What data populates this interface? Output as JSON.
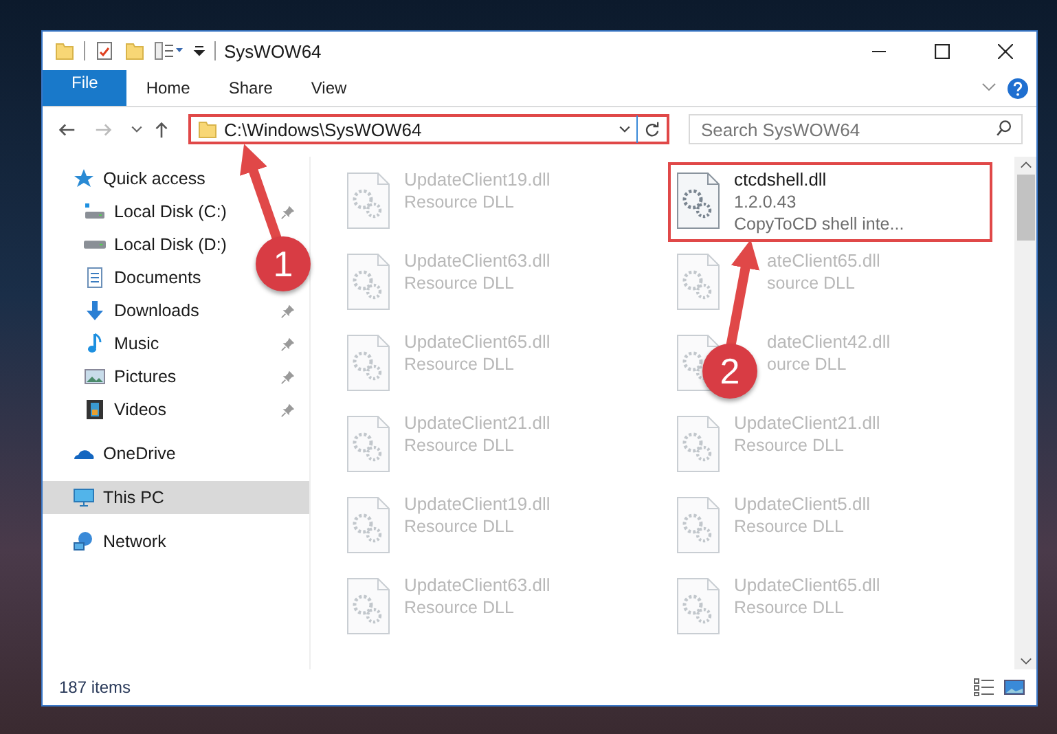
{
  "window": {
    "title": "SysWOW64"
  },
  "ribbon_tabs": [
    {
      "label": "File",
      "kind": "file"
    },
    {
      "label": "Home",
      "kind": "tab"
    },
    {
      "label": "Share",
      "kind": "tab"
    },
    {
      "label": "View",
      "kind": "tab"
    }
  ],
  "address_bar": {
    "path": "C:\\Windows\\SysWOW64",
    "highlighted": true
  },
  "search": {
    "placeholder": "Search SysWOW64"
  },
  "navigation": [
    {
      "label": "Quick access",
      "kind": "quick",
      "selected": false,
      "children": [
        {
          "label": "Local Disk (C:)",
          "kind": "system-drive",
          "pinned": true
        },
        {
          "label": "Local Disk (D:)",
          "kind": "drive",
          "pinned": false
        },
        {
          "label": "Documents",
          "kind": "folder-documents",
          "pinned": false
        },
        {
          "label": "Downloads",
          "kind": "folder-downloads",
          "pinned": true
        },
        {
          "label": "Music",
          "kind": "folder-music",
          "pinned": true
        },
        {
          "label": "Pictures",
          "kind": "folder-pictures",
          "pinned": true
        },
        {
          "label": "Videos",
          "kind": "folder-videos",
          "pinned": true
        }
      ]
    },
    {
      "label": "OneDrive",
      "kind": "cloud-storage",
      "selected": false
    },
    {
      "label": "This PC",
      "kind": "computer",
      "selected": true
    },
    {
      "label": "Network",
      "kind": "network",
      "selected": false
    }
  ],
  "files": [
    {
      "name": "UpdateClient19.dll",
      "description": "Resource DLL",
      "blurred": true,
      "highlighted": false,
      "covered": false
    },
    {
      "name": "ctcdshell.dll",
      "version": "1.2.0.43",
      "description": "CopyToCD shell inte...",
      "blurred": false,
      "highlighted": true,
      "covered": false
    },
    {
      "name": "UpdateClient63.dll",
      "description": "Resource DLL",
      "blurred": true,
      "highlighted": false,
      "covered": false
    },
    {
      "name": "ateClient65.dll",
      "description": "source DLL",
      "blurred": true,
      "highlighted": false,
      "covered": true
    },
    {
      "name": "UpdateClient65.dll",
      "description": "Resource DLL",
      "blurred": true,
      "highlighted": false,
      "covered": false
    },
    {
      "name": "dateClient42.dll",
      "description": "ource DLL",
      "blurred": true,
      "highlighted": false,
      "covered": true
    },
    {
      "name": "UpdateClient21.dll",
      "description": "Resource DLL",
      "blurred": true,
      "highlighted": false,
      "covered": false
    },
    {
      "name": "UpdateClient21.dll",
      "description": "Resource DLL",
      "blurred": true,
      "highlighted": false,
      "covered": false
    },
    {
      "name": "UpdateClient19.dll",
      "description": "Resource DLL",
      "blurred": true,
      "highlighted": false,
      "covered": false
    },
    {
      "name": "UpdateClient5.dll",
      "description": "Resource DLL",
      "blurred": true,
      "highlighted": false,
      "covered": false
    },
    {
      "name": "UpdateClient63.dll",
      "description": "Resource DLL",
      "blurred": true,
      "highlighted": false,
      "covered": false
    },
    {
      "name": "UpdateClient65.dll",
      "description": "Resource DLL",
      "blurred": true,
      "highlighted": false,
      "covered": false
    }
  ],
  "status_bar": {
    "item_count": "187 items"
  },
  "annotations": [
    {
      "number": "1"
    },
    {
      "number": "2"
    }
  ]
}
